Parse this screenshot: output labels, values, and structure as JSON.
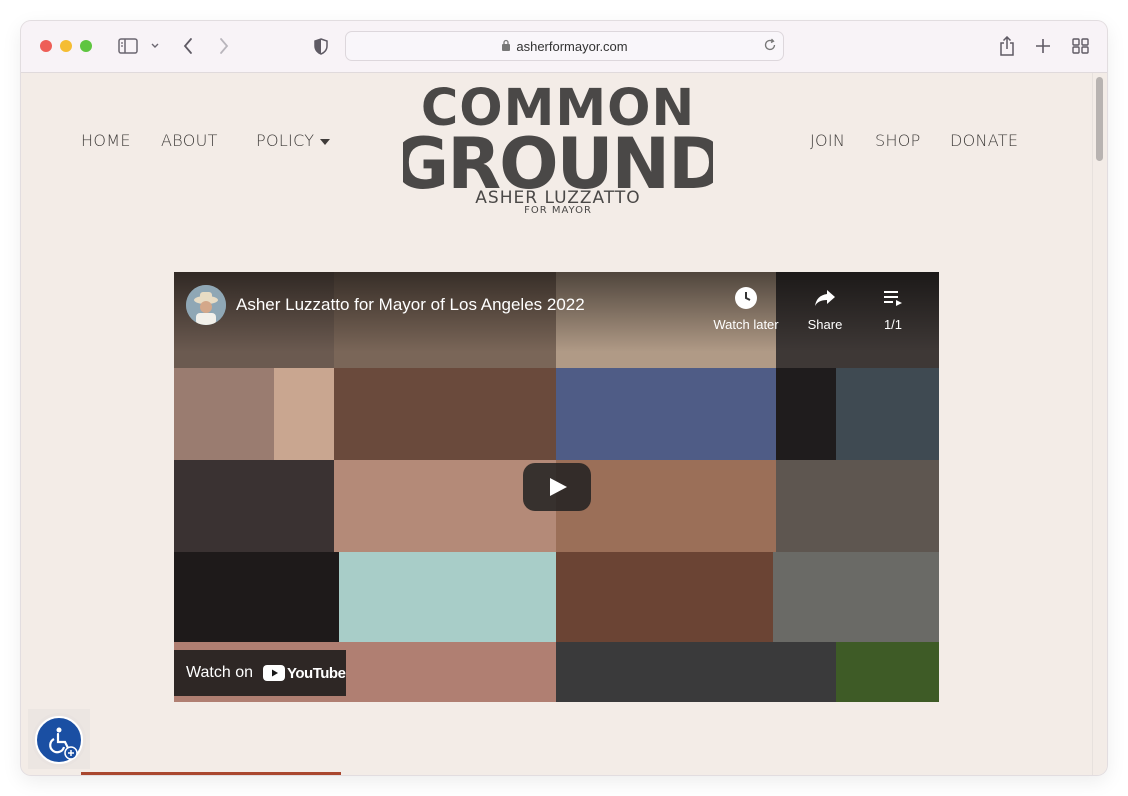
{
  "browser": {
    "url": "asherformayor.com",
    "icons": [
      "sidebar-icon",
      "chevron-down-icon",
      "back-icon",
      "forward-icon",
      "shield-icon",
      "lock-icon",
      "reload-icon",
      "share-icon",
      "new-tab-icon",
      "tab-overview-icon"
    ]
  },
  "nav": {
    "left": [
      {
        "label": "HOME"
      },
      {
        "label": "ABOUT"
      },
      {
        "label": "POLICY"
      }
    ],
    "right": [
      {
        "label": "JOIN"
      },
      {
        "label": "SHOP"
      },
      {
        "label": "DONATE"
      }
    ]
  },
  "logo": {
    "line1": "COMMON",
    "line2": "GROUND",
    "line3": "ASHER LUZZATTO",
    "line4": "FOR MAYOR"
  },
  "video": {
    "title": "Asher Luzzatto for Mayor of Los Angeles 2022",
    "watch_later": "Watch later",
    "share": "Share",
    "playlist": "1/1",
    "watch_on": "Watch on",
    "youtube": "YouTube"
  },
  "colors": {
    "page_bg": "#f3ece7",
    "logo": "#4a4847",
    "accent_line": "#a9472f",
    "accessibility": "#1a4fa3"
  }
}
